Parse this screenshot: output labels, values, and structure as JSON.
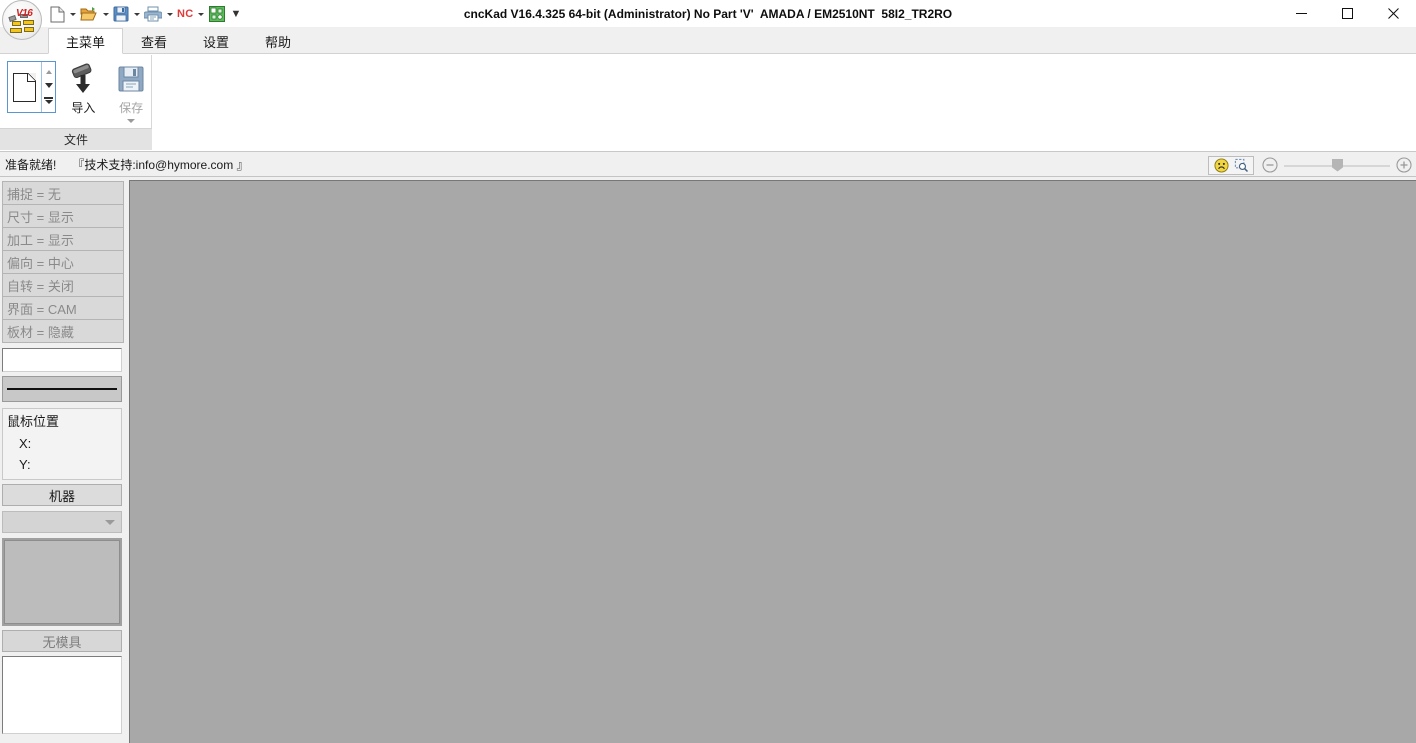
{
  "window": {
    "title": "cncKad V16.4.325 64-bit (Administrator) No Part 'V'  AMADA / EM2510NT  58I2_TR2RO",
    "logo_text": "V16",
    "controls": {
      "minimize": "最小化",
      "maximize": "最大化",
      "close": "关闭"
    }
  },
  "quick_access": {
    "items": [
      {
        "name": "new-file",
        "icon": "page-icon",
        "has_dropdown": true
      },
      {
        "name": "open-file",
        "icon": "folder-open-icon",
        "has_dropdown": true
      },
      {
        "name": "save-file",
        "icon": "floppy-disk-icon",
        "has_dropdown": true
      },
      {
        "name": "print",
        "icon": "printer-icon",
        "has_dropdown": true
      },
      {
        "name": "nc-code",
        "icon": "nc-text-icon",
        "label": "NC",
        "has_dropdown": true
      },
      {
        "name": "nest",
        "icon": "green-squares-icon",
        "has_dropdown": false
      }
    ],
    "overflow_label": "▼"
  },
  "tabs": [
    {
      "label": "主菜单",
      "active": true
    },
    {
      "label": "查看",
      "active": false
    },
    {
      "label": "设置",
      "active": false
    },
    {
      "label": "帮助",
      "active": false
    }
  ],
  "ribbon": {
    "group_label": "文件",
    "new_button": {
      "name": "new-drawing",
      "icon": "page-icon"
    },
    "buttons": [
      {
        "name": "import",
        "label": "导入",
        "icon": "import-icon",
        "disabled": false,
        "dropdown": false
      },
      {
        "name": "save",
        "label": "保存",
        "icon": "floppy-disk-icon",
        "disabled": true,
        "dropdown": true
      }
    ]
  },
  "status": {
    "message": "准备就绪!",
    "support": "『技术支持:info@hymore.com 』",
    "icons": [
      {
        "name": "sad-face-icon"
      },
      {
        "name": "zoom-selection-icon"
      }
    ],
    "zoom": {
      "minus_label": "−",
      "plus_label": "+",
      "value": 45
    }
  },
  "sidebar": {
    "properties": [
      {
        "key": "捕捉",
        "value": "无",
        "text": "捕捉 = 无"
      },
      {
        "key": "尺寸",
        "value": "显示",
        "text": "尺寸 = 显示"
      },
      {
        "key": "加工",
        "value": "显示",
        "text": "加工 = 显示"
      },
      {
        "key": "偏向",
        "value": "中心",
        "text": "偏向 = 中心"
      },
      {
        "key": "自转",
        "value": "关闭",
        "text": "自转 = 关闭"
      },
      {
        "key": "界面",
        "value": "CAM",
        "text": "界面 = CAM"
      },
      {
        "key": "板材",
        "value": "隐藏",
        "text": "板材 = 隐藏"
      }
    ],
    "text_input": {
      "value": "",
      "placeholder": ""
    },
    "mouse_position": {
      "title": "鼠标位置",
      "x_label": "X:",
      "x_value": "",
      "y_label": "Y:",
      "y_value": ""
    },
    "machine_header": "机器",
    "machine_combo": {
      "value": ""
    },
    "tool_header": "无模具"
  },
  "colors": {
    "canvas": "#a8a8a8",
    "accent": "#5a96d2",
    "nc_red": "#e03a3a",
    "disabled_text": "#8a8a8a"
  }
}
